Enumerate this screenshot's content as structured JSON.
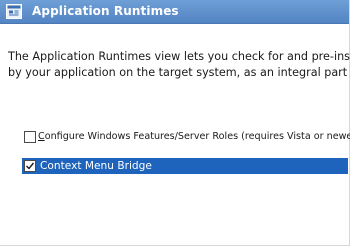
{
  "window": {
    "title": "Application Runtimes",
    "icon": "window-app-icon"
  },
  "description": {
    "line1": "The Application Runtimes view lets you check for and pre-install",
    "line2": "by your application on the target system, as an integral part of"
  },
  "runtimes": [
    {
      "label_accel": "C",
      "label_rest": "onfigure Windows Features/Server Roles (requires Vista or newer)",
      "checked": false,
      "selected": false
    },
    {
      "label": "Context Menu Bridge",
      "checked": true,
      "selected": true
    }
  ],
  "colors": {
    "titlebar": "#5b8bca",
    "selection": "#1e64bd"
  }
}
